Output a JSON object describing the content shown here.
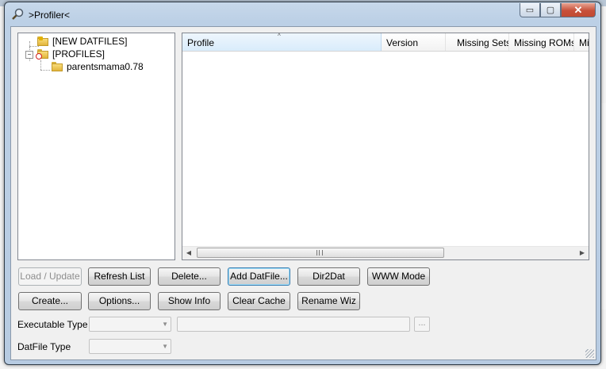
{
  "window": {
    "title": ">Profiler<",
    "controls": {
      "minimize": "▭",
      "maximize": "▢",
      "close": "✕"
    }
  },
  "tree": {
    "items": [
      {
        "label": "[NEW DATFILES]"
      },
      {
        "label": "[PROFILES]",
        "expander": "−"
      },
      {
        "label": "parentsmama0.78"
      }
    ]
  },
  "list": {
    "columns": [
      "Profile",
      "Version",
      "Missing Sets",
      "Missing ROMs",
      "Mi"
    ],
    "sort_indicator": "^",
    "scroll_left": "◀",
    "scroll_right": "▶",
    "rows": []
  },
  "buttons": {
    "row1": [
      "Load / Update",
      "Refresh List",
      "Delete...",
      "Add DatFile...",
      "Dir2Dat",
      "WWW Mode"
    ],
    "row2": [
      "Create...",
      "Options...",
      "Show Info",
      "Clear Cache",
      "Rename Wiz"
    ]
  },
  "fields": {
    "executable_type_label": "Executable Type",
    "datfile_type_label": "DatFile Type",
    "executable_type_value": "",
    "datfile_type_value": "",
    "path_value": "",
    "browse_label": "...",
    "dropdown_arrow": "▼"
  },
  "colors": {
    "accent_focus": "#3c7fb1",
    "close_button": "#c7503a",
    "folder": "#e2b53b",
    "error_badge": "#d02020"
  }
}
